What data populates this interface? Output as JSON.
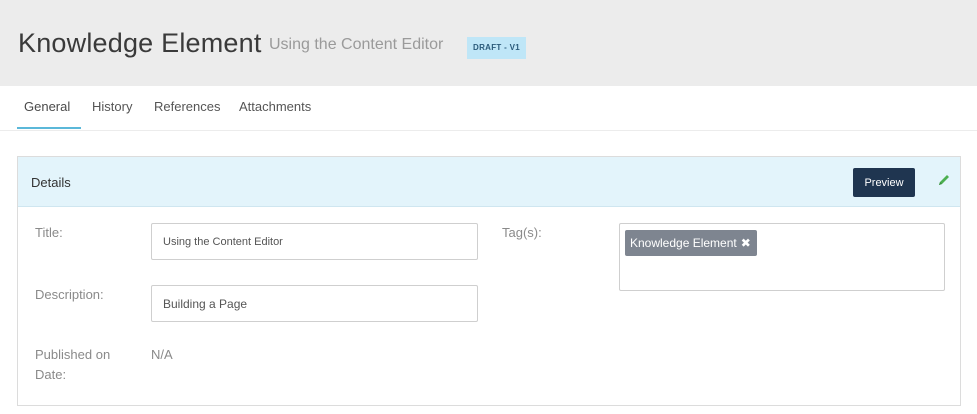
{
  "header": {
    "title": "Knowledge Element",
    "subtitle": "Using the Content Editor",
    "status_badge": "DRAFT - V1"
  },
  "tabs": [
    {
      "label": "General",
      "active": true
    },
    {
      "label": "History",
      "active": false
    },
    {
      "label": "References",
      "active": false
    },
    {
      "label": "Attachments",
      "active": false
    }
  ],
  "details": {
    "heading": "Details",
    "preview_label": "Preview",
    "edit_icon": "pencil-icon",
    "fields": {
      "title_label": "Title:",
      "title_value": "Using the Content Editor",
      "description_label": "Description:",
      "description_value": "Building a Page",
      "published_label_line1": "Published on",
      "published_label_line2": "Date:",
      "published_value": "N/A",
      "tags_label": "Tag(s):",
      "tags": [
        "Knowledge Element"
      ],
      "tag_remove_glyph": "✖"
    }
  },
  "colors": {
    "header_bg": "#ececec",
    "badge_bg": "#bfe6f7",
    "tab_accent": "#5bb8d9",
    "panel_head_bg": "#e3f4fb",
    "preview_btn_bg": "#1f3550",
    "edit_icon": "#4caf50",
    "tag_bg": "#7e8590"
  }
}
